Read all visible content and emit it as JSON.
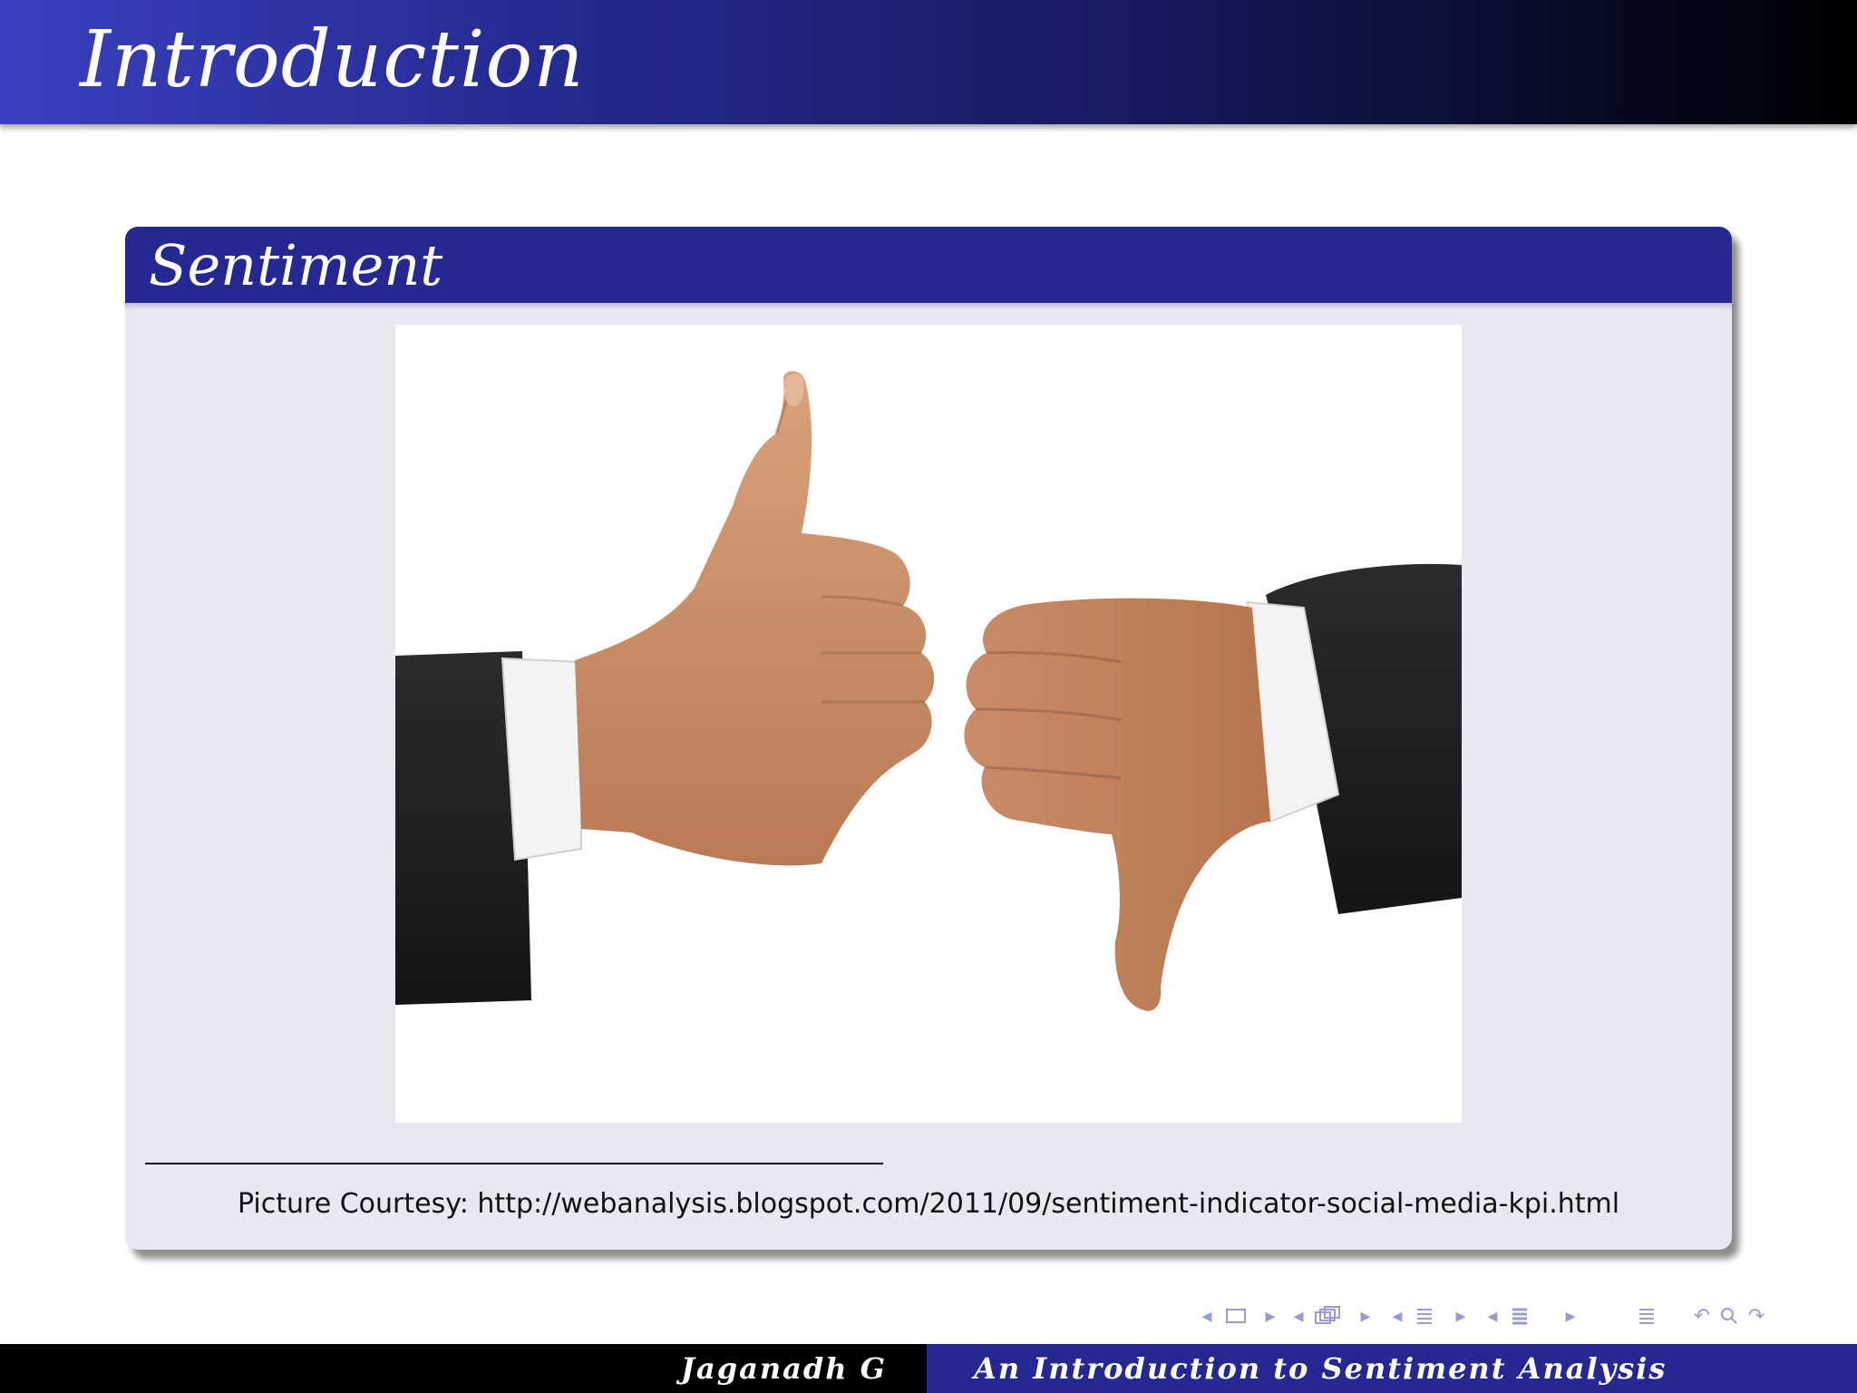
{
  "frame": {
    "title": "Introduction"
  },
  "block": {
    "title": "Sentiment",
    "image_description": "Two hands in dark suit sleeves: left hand thumbs up, right hand thumbs down"
  },
  "footnote": {
    "text": "Picture Courtesy: http://webanalysis.blogspot.com/2011/09/sentiment-indicator-social-media-kpi.html"
  },
  "footer": {
    "author": "Jaganadh G",
    "talk_title": "An Introduction to Sentiment Analysis"
  },
  "navigation": {
    "icons": [
      "nav-prev-arrow-icon",
      "slide-icon",
      "nav-next-arrow-icon",
      "frame-icon",
      "section-icon",
      "subsection-icon",
      "toc-icon",
      "search-icon",
      "undo-icon"
    ]
  },
  "colors": {
    "title_bar_start": "#3a3fbf",
    "title_bar_end": "#000000",
    "block_header": "#252890",
    "block_body": "#e9e8f1",
    "nav_symbols": "#9b9bd0"
  }
}
